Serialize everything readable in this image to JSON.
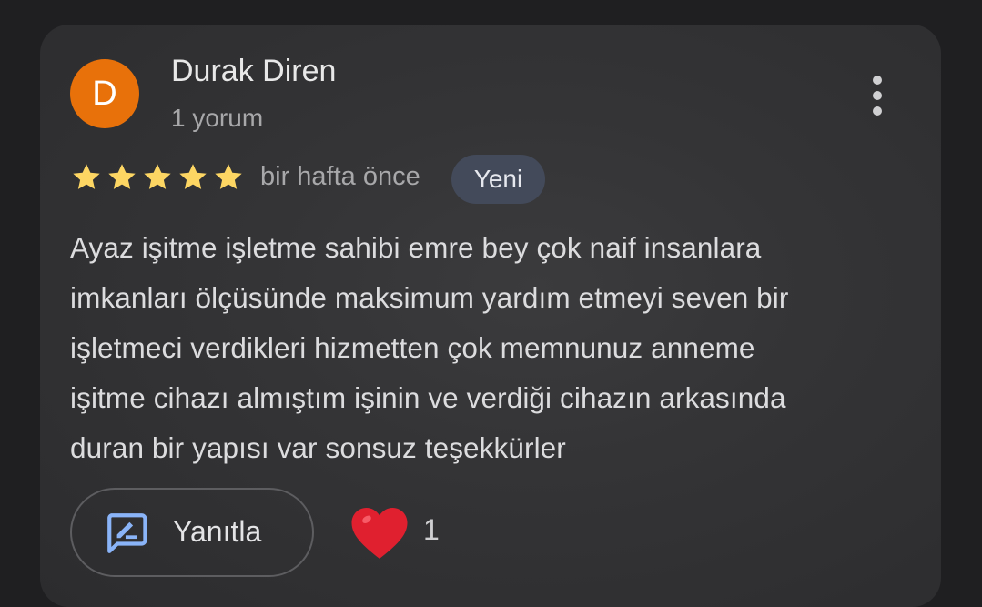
{
  "review": {
    "author": {
      "initial": "D",
      "name": "Durak Diren",
      "review_count": "1 yorum",
      "avatar_color": "#e8710a"
    },
    "rating": {
      "stars": 5,
      "max_stars": 5,
      "star_color": "#fdd663"
    },
    "timestamp": "bir hafta önce",
    "badge": "Yeni",
    "text_lines": [
      "Ayaz işitme işletme sahibi emre bey çok naif insanlara",
      "imkanları ölçüsünde maksimum yardım etmeyi seven bir",
      "işletmeci verdikleri hizmetten çok memnunuz anneme",
      "işitme cihazı almıştım işinin ve verdiği cihazın arkasında",
      "duran bir yapısı var sonsuz teşekkürler"
    ],
    "more_icon": "more-vert-icon"
  },
  "actions": {
    "reply_label": "Yanıtla",
    "reply_icon": "rate-review-icon",
    "reply_icon_color": "#8ab4f8",
    "like_icon": "heart-icon",
    "like_color": "#e0202f",
    "like_count": "1"
  }
}
